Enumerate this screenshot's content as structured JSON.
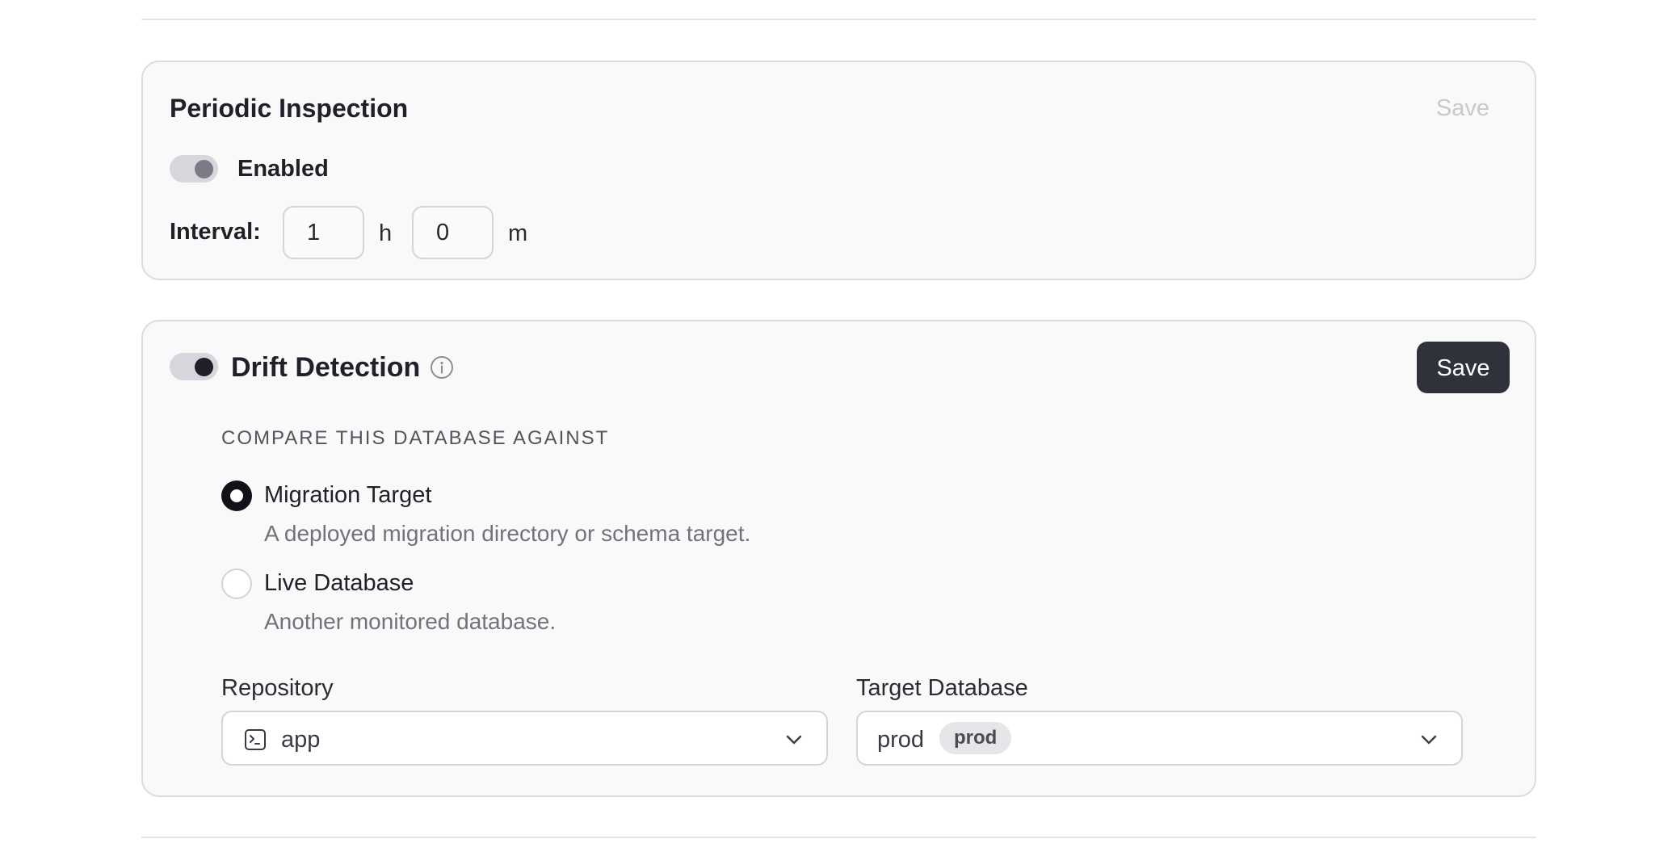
{
  "periodic_inspection": {
    "title": "Periodic Inspection",
    "save_label": "Save",
    "toggle_label": "Enabled",
    "interval_label": "Interval:",
    "hours_value": "1",
    "hours_unit": "h",
    "minutes_value": "0",
    "minutes_unit": "m"
  },
  "drift_detection": {
    "title": "Drift Detection",
    "save_label": "Save",
    "compare_heading": "COMPARE THIS DATABASE AGAINST",
    "options": [
      {
        "title": "Migration Target",
        "description": "A deployed migration directory or schema target.",
        "selected": true
      },
      {
        "title": "Live Database",
        "description": "Another monitored database.",
        "selected": false
      }
    ],
    "repository": {
      "label": "Repository",
      "value": "app"
    },
    "target_database": {
      "label": "Target Database",
      "value": "prod",
      "badge": "prod"
    }
  },
  "colors": {
    "accent": "#2f313b",
    "card_bg": "#f9f9f9",
    "border": "#dcdcdf"
  },
  "icons": {
    "info": "info-icon",
    "terminal": "terminal-icon",
    "chevron": "chevron-down-icon"
  }
}
